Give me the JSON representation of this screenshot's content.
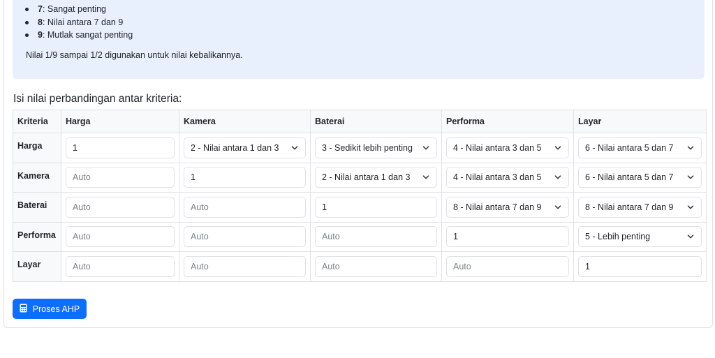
{
  "scale_info": {
    "items": [
      {
        "key": "7",
        "text": ": Sangat penting"
      },
      {
        "key": "8",
        "text": ": Nilai antara 7 dan 9"
      },
      {
        "key": "9",
        "text": ": Mutlak sangat penting"
      }
    ],
    "note": "Nilai 1/9 sampai 1/2 digunakan untuk nilai kebalikannya."
  },
  "section_title": "Isi nilai perbandingan antar kriteria:",
  "table": {
    "header": [
      "Kriteria",
      "Harga",
      "Kamera",
      "Baterai",
      "Performa",
      "Layar"
    ],
    "rows": [
      {
        "label": "Harga",
        "cells": [
          {
            "type": "input",
            "value": "1"
          },
          {
            "type": "select",
            "value": "2 - Nilai antara 1 dan 3"
          },
          {
            "type": "select",
            "value": "3 - Sedikit lebih penting"
          },
          {
            "type": "select",
            "value": "4 - Nilai antara 3 dan 5"
          },
          {
            "type": "select",
            "value": "6 - Nilai antara 5 dan 7"
          }
        ]
      },
      {
        "label": "Kamera",
        "cells": [
          {
            "type": "input",
            "placeholder": "Auto"
          },
          {
            "type": "input",
            "value": "1"
          },
          {
            "type": "select",
            "value": "2 - Nilai antara 1 dan 3"
          },
          {
            "type": "select",
            "value": "4 - Nilai antara 3 dan 5"
          },
          {
            "type": "select",
            "value": "6 - Nilai antara 5 dan 7"
          }
        ]
      },
      {
        "label": "Baterai",
        "cells": [
          {
            "type": "input",
            "placeholder": "Auto"
          },
          {
            "type": "input",
            "placeholder": "Auto"
          },
          {
            "type": "input",
            "value": "1"
          },
          {
            "type": "select",
            "value": "8 - Nilai antara 7 dan 9"
          },
          {
            "type": "select",
            "value": "8 - Nilai antara 7 dan 9"
          }
        ]
      },
      {
        "label": "Performa",
        "cells": [
          {
            "type": "input",
            "placeholder": "Auto"
          },
          {
            "type": "input",
            "placeholder": "Auto"
          },
          {
            "type": "input",
            "placeholder": "Auto"
          },
          {
            "type": "input",
            "value": "1"
          },
          {
            "type": "select",
            "value": "5 - Lebih penting"
          }
        ]
      },
      {
        "label": "Layar",
        "cells": [
          {
            "type": "input",
            "placeholder": "Auto"
          },
          {
            "type": "input",
            "placeholder": "Auto"
          },
          {
            "type": "input",
            "placeholder": "Auto"
          },
          {
            "type": "input",
            "placeholder": "Auto"
          },
          {
            "type": "input",
            "value": "1"
          }
        ]
      }
    ]
  },
  "submit_button": {
    "label": "Proses AHP",
    "icon": "calculator-icon"
  },
  "colors": {
    "primary": "#0d6efd",
    "info_bg": "#e8f0fd",
    "header_bg": "#f8f9fa",
    "border": "#dee2e6"
  }
}
